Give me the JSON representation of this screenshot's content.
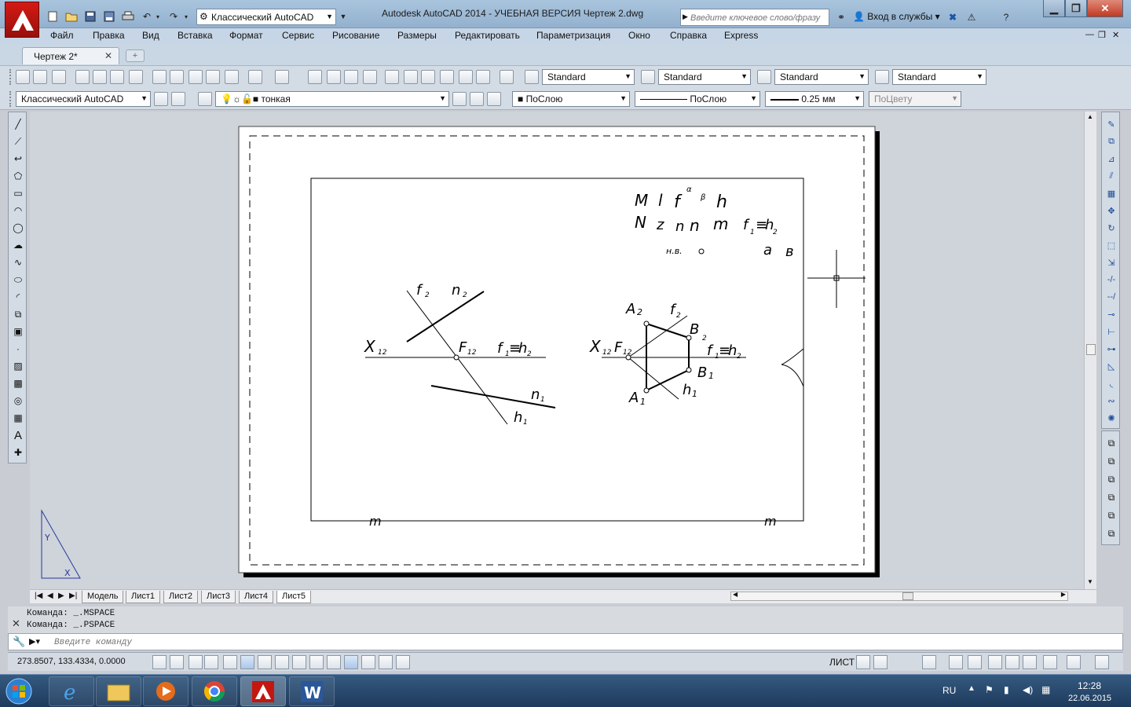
{
  "window": {
    "title": "Autodesk AutoCAD 2014 - УЧЕБНАЯ ВЕРСИЯ     Чертеж 2.dwg",
    "workspace": "Классический AutoCAD",
    "search_placeholder": "Введите ключевое слово/фразу",
    "sign_in": "Вход в службы",
    "minimize": "▁",
    "maximize": "❐",
    "close": "✕"
  },
  "menu": [
    "Файл",
    "Правка",
    "Вид",
    "Вставка",
    "Формат",
    "Сервис",
    "Рисование",
    "Размеры",
    "Редактировать",
    "Параметризация",
    "Окно",
    "Справка",
    "Express"
  ],
  "tabs": {
    "document": "Чертеж 2*",
    "close": "✕"
  },
  "toolbar1": {
    "text_style": "Standard",
    "dim_style": "Standard",
    "table_style": "Standard",
    "mleader_style": "Standard"
  },
  "toolbar2": {
    "workspace": "Классический AutoCAD",
    "layer": "тонкая",
    "color": "ПоСлою",
    "linetype": "ПоСлою",
    "lineweight": "0.25 мм",
    "plotstyle": "ПоЦвету"
  },
  "drawing_labels": {
    "top_M": "M",
    "top_l": "l",
    "top_f": "f",
    "top_alpha": "α",
    "top_beta": "β",
    "top_h": "h",
    "top_N": "N",
    "top_z": "z",
    "top_n1": "n",
    "top_n2": "n",
    "top_m": "m",
    "top_f1": "f",
    "top_eq": "≡",
    "top_h2": "h",
    "top_sub1": "1",
    "top_sub2": "2",
    "nv": "н.в.",
    "a": "a",
    "b": "в",
    "f2": "f",
    "f2s": "2",
    "n2": "n",
    "n2s": "2",
    "x12": "X",
    "x12s": "12",
    "F12": "F",
    "F12s": "12",
    "f1h2a": "f",
    "f1h2s1": "1",
    "f1h2eq": "≡",
    "f1h2h": "h",
    "f1h2s2": "2",
    "n1": "n",
    "n1s": "1",
    "h1": "h",
    "h1s": "1",
    "rX": "X",
    "rXs": "12",
    "rF": "F",
    "rFs": "12",
    "A2": "A",
    "A2s": "2",
    "rf2": "f",
    "rf2s": "2",
    "B2": "B",
    "B2s": "2",
    "rf1": "f",
    "rf1s": "1",
    "req": "≡",
    "rh": "h",
    "rhs": "2",
    "B1": "B",
    "B1s": "1",
    "rh1": "h",
    "rh1s": "1",
    "A1": "A",
    "A1s": "1",
    "bottom_m1": "m",
    "bottom_m2": "m"
  },
  "ucs": {
    "y": "Y",
    "x": "X"
  },
  "layout_tabs": [
    "Модель",
    "Лист1",
    "Лист2",
    "Лист3",
    "Лист4",
    "Лист5"
  ],
  "active_layout": "Лист5",
  "command": {
    "history": [
      "Команда:  _.MSPACE",
      "Команда:  _.PSPACE"
    ],
    "placeholder": "Введите команду"
  },
  "status": {
    "coords": "273.8507, 133.4334, 0.0000",
    "space": "ЛИСТ"
  },
  "tray": {
    "lang": "RU",
    "time": "12:28",
    "date": "22.06.2015"
  },
  "colors": {
    "accent_red": "#c4170f",
    "titlebar": "#9fbbd7",
    "toolbar": "#d3dbe4",
    "taskbar": "#26466a"
  }
}
